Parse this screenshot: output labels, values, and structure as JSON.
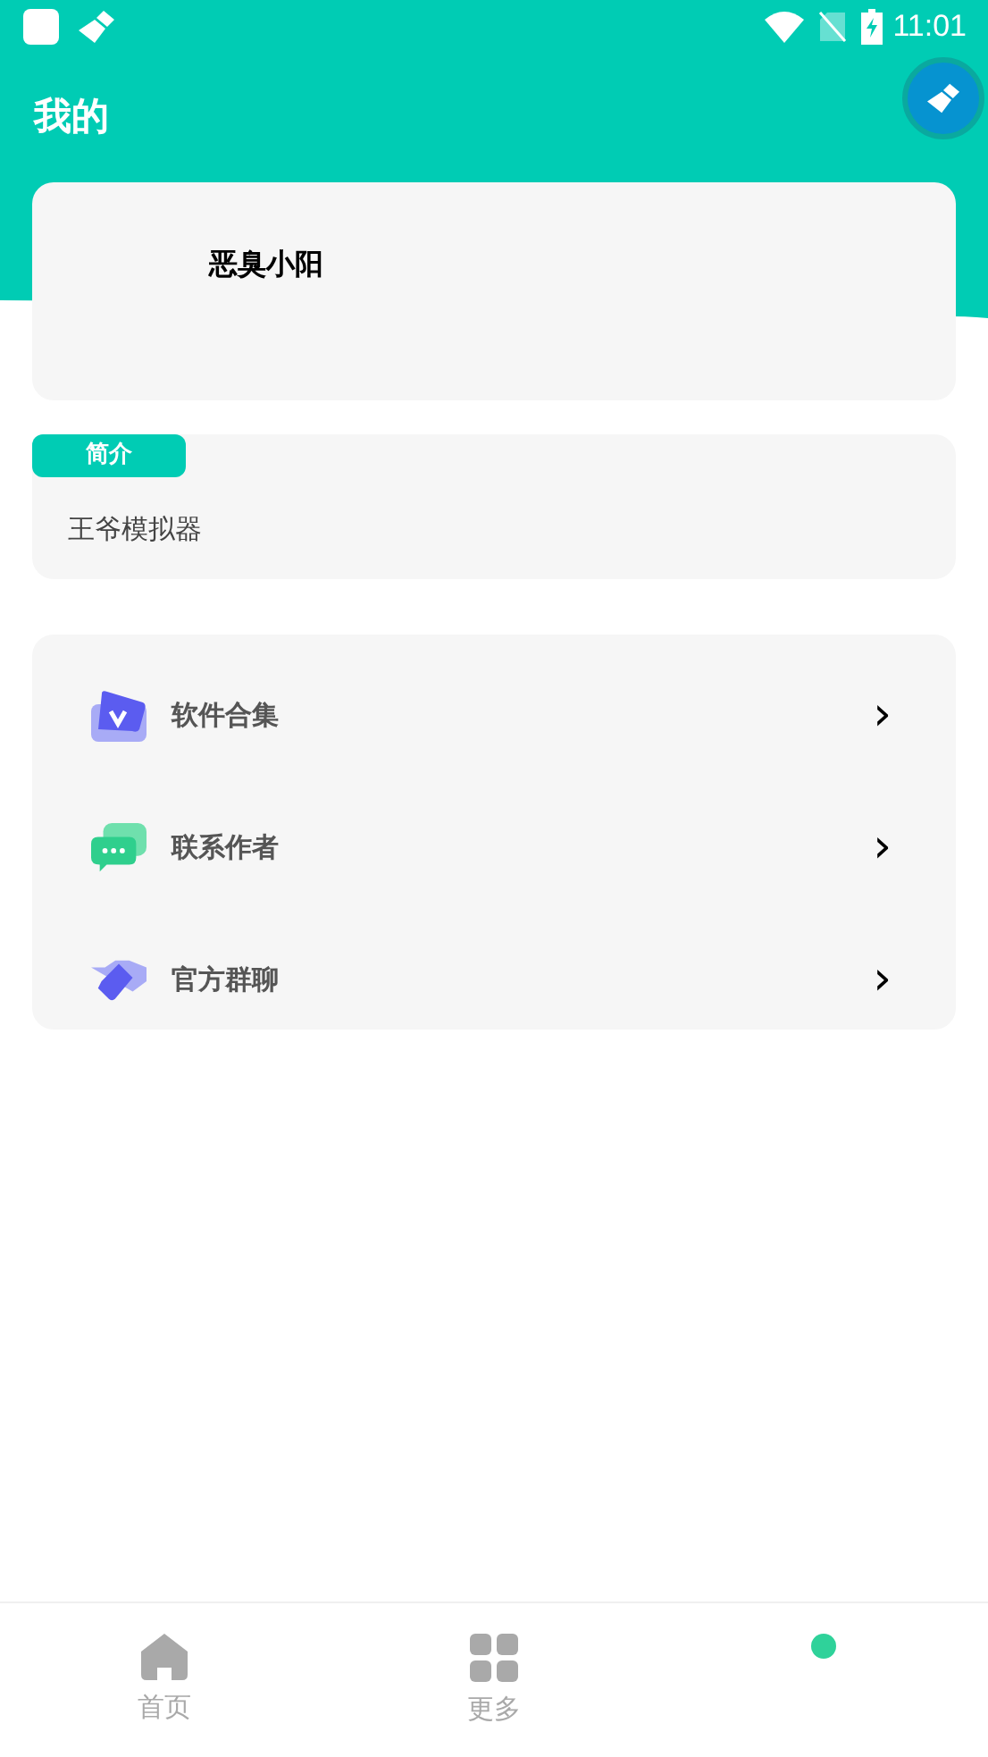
{
  "status_bar": {
    "time": "11:01"
  },
  "header": {
    "title": "我的"
  },
  "profile": {
    "name": "恶臭小阳"
  },
  "intro": {
    "badge": "简介",
    "text": "王爷模拟器"
  },
  "menu": [
    {
      "kind": "software",
      "label": "软件合集",
      "chevron": "›"
    },
    {
      "kind": "contact",
      "label": "联系作者",
      "chevron": "›"
    },
    {
      "kind": "group",
      "label": "官方群聊",
      "chevron": "›"
    }
  ],
  "bottom_nav": [
    {
      "kind": "home",
      "label": "首页",
      "selected": false
    },
    {
      "kind": "more",
      "label": "更多",
      "selected": false
    },
    {
      "kind": "mine",
      "selected": true
    }
  ]
}
